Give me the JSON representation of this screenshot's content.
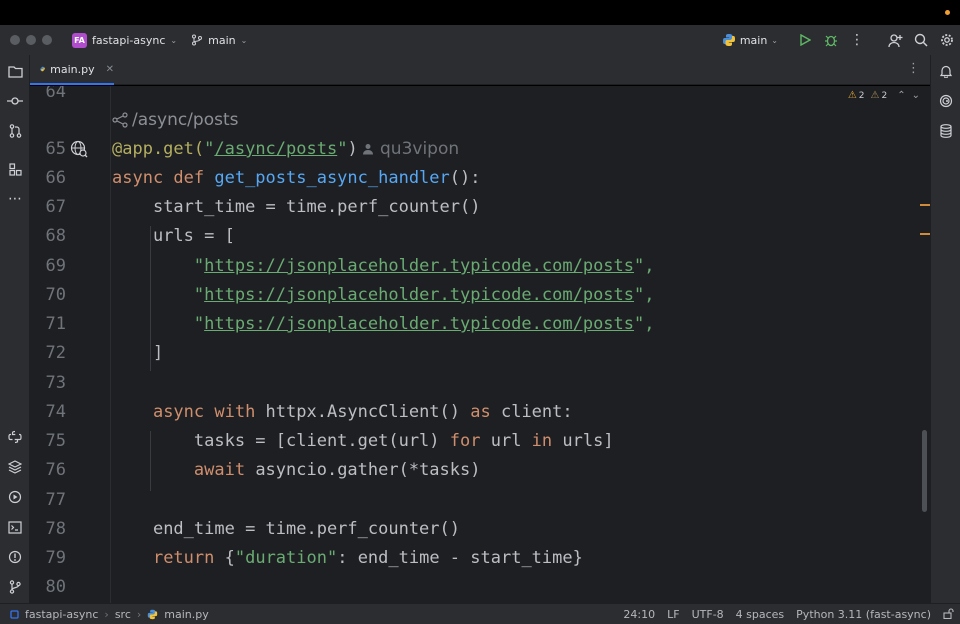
{
  "window": {
    "project_initials": "FA",
    "project_name": "fastapi-async",
    "vcs_branch": "main",
    "run_config": "main"
  },
  "tabs": [
    {
      "label": "main.py",
      "icon": "python-file-icon",
      "active": true
    }
  ],
  "inspection": {
    "warnings": "2",
    "weak_warnings": "2"
  },
  "editor": {
    "route_hint": "/async/posts",
    "author": "qu3vipon",
    "lines": [
      {
        "num": "64"
      },
      {
        "num": "65"
      },
      {
        "num": "66"
      },
      {
        "num": "67"
      },
      {
        "num": "68"
      },
      {
        "num": "69"
      },
      {
        "num": "70"
      },
      {
        "num": "71"
      },
      {
        "num": "72"
      },
      {
        "num": "73"
      },
      {
        "num": "74"
      },
      {
        "num": "75"
      },
      {
        "num": "76"
      },
      {
        "num": "77"
      },
      {
        "num": "78"
      },
      {
        "num": "79"
      },
      {
        "num": "80"
      }
    ],
    "code": {
      "l65_dec": "@app.get(",
      "l65_q1": "\"",
      "l65_path": "/async/posts",
      "l65_q2": "\"",
      "l65_close": ")",
      "l66_kw": "async def ",
      "l66_fn": "get_posts_async_handler",
      "l66_rest": "():",
      "l67": "start_time = time.perf_counter()",
      "l68": "urls = [",
      "url": "https://jsonplaceholder.typicode.com/posts",
      "quote": "\"",
      "url_tail": "\",",
      "l72": "]",
      "l74_kw1": "async with ",
      "l74_mid": "httpx.AsyncClient() ",
      "l74_kw2": "as ",
      "l74_end": "client:",
      "l75_a": "tasks = [client.get(url) ",
      "l75_for": "for ",
      "l75_b": "url ",
      "l75_in": "in ",
      "l75_c": "urls]",
      "l76_kw": "await ",
      "l76_rest": "asyncio.gather(*tasks)",
      "l78": "end_time = time.perf_counter()",
      "l79_kw": "return ",
      "l79_a": "{",
      "l79_key": "\"duration\"",
      "l79_b": ": end_time - start_time}"
    }
  },
  "statusbar": {
    "crumbs": [
      "fastapi-async",
      "src",
      "main.py"
    ],
    "position": "24:10",
    "line_sep": "LF",
    "encoding": "UTF-8",
    "indent": "4 spaces",
    "interpreter": "Python 3.11 (fast-async)"
  },
  "colors": {
    "editor_bg": "#1e1f22",
    "panel_bg": "#2b2d30",
    "keyword": "#cf8e6d",
    "string": "#6aab73",
    "function": "#56a8f5",
    "decorator": "#b3ae60",
    "accent": "#3574f0"
  }
}
